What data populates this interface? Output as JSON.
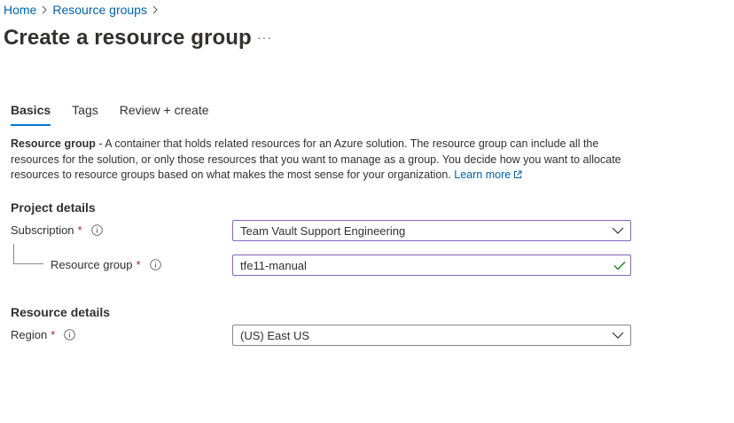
{
  "breadcrumb": {
    "items": [
      {
        "label": "Home"
      },
      {
        "label": "Resource groups"
      }
    ]
  },
  "page": {
    "title": "Create a resource group",
    "more_label": "···"
  },
  "tabs": [
    {
      "label": "Basics",
      "active": true
    },
    {
      "label": "Tags",
      "active": false
    },
    {
      "label": "Review + create",
      "active": false
    }
  ],
  "description": {
    "term": "Resource group",
    "text": " - A container that holds related resources for an Azure solution. The resource group can include all the resources for the solution, or only those resources that you want to manage as a group. You decide how you want to allocate resources to resource groups based on what makes the most sense for your organization.",
    "link_label": "Learn more"
  },
  "project_details": {
    "heading": "Project details",
    "subscription": {
      "label": "Subscription",
      "required_marker": "*",
      "value": "Team Vault Support Engineering"
    },
    "resource_group": {
      "label": "Resource group",
      "required_marker": "*",
      "value": "tfe11-manual"
    }
  },
  "resource_details": {
    "heading": "Resource details",
    "region": {
      "label": "Region",
      "required_marker": "*",
      "value": "(US) East US"
    }
  },
  "colors": {
    "link": "#0062ad",
    "accent": "#0078d4",
    "focus_border": "#8764b8",
    "required": "#a4262c",
    "success": "#107c10"
  },
  "icons": {
    "breadcrumb_separator": "chevron-right-icon",
    "more": "more-icon",
    "info": "info-icon",
    "external_link": "external-link-icon",
    "dropdown": "chevron-down-icon",
    "valid": "checkmark-icon"
  }
}
